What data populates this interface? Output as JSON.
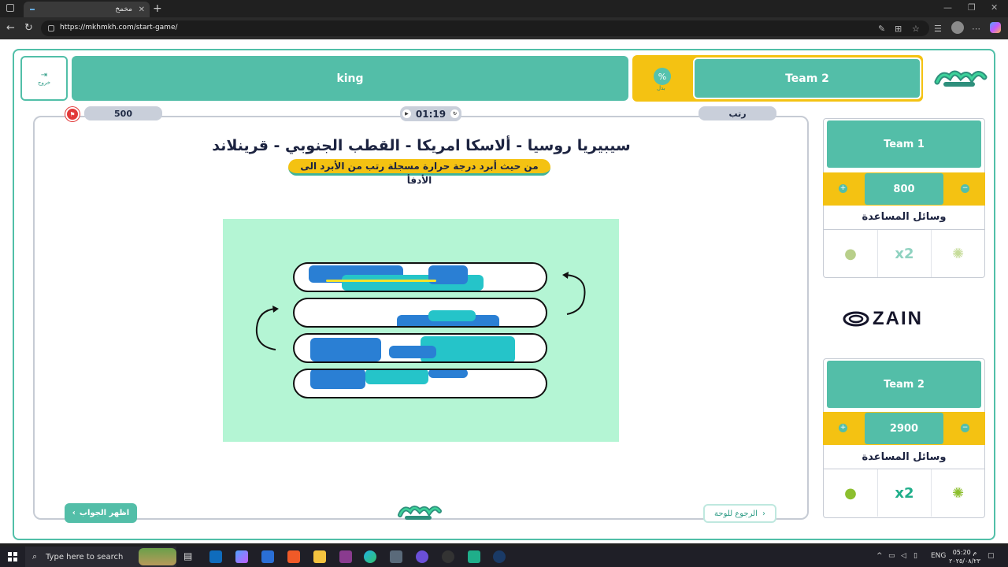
{
  "browser": {
    "tab_title": "مخمخ",
    "url": "https://mkhmkh.com/start-game/"
  },
  "header": {
    "exit_label": "خروج",
    "current_team": "Team 2",
    "other_player": "king",
    "turn_icon_label": "بدل"
  },
  "game": {
    "score_value": "500",
    "timer": "01:19",
    "arrange_label": "رتب",
    "question": "سيبيريا روسيا - ألاسكا امريكا - القطب الجنوبي - قرينلاند",
    "hint": "من حيث أبرد درجة حرارة مسجلة رتب من الأبرد الى الأدفأ",
    "show_answer": "اظهر الجواب",
    "back_to_board": "الرجوع للوحة",
    "logo_text": "مخمخ"
  },
  "teams": [
    {
      "name": "Team 1",
      "score": "800",
      "help_title": "وسائل المساعدة",
      "help_tools": [
        "thinking-icon",
        "double-icon",
        "lime-icon"
      ]
    },
    {
      "name": "Team 2",
      "score": "2900",
      "help_title": "وسائل المساعدة",
      "help_tools": [
        "thinking-icon",
        "double-icon",
        "lime-icon"
      ]
    }
  ],
  "help_double_label": "x2",
  "sponsor": "ZAIN",
  "taskbar": {
    "search_placeholder": "Type here to search",
    "lang": "ENG",
    "time": "05:20 م",
    "date": "٢٠٢٥/٠٨/٢٣"
  },
  "colors": {
    "teal": "#53bea8",
    "yellow": "#f4c212",
    "mint": "#b4f5d4",
    "navy": "#1c2340"
  }
}
